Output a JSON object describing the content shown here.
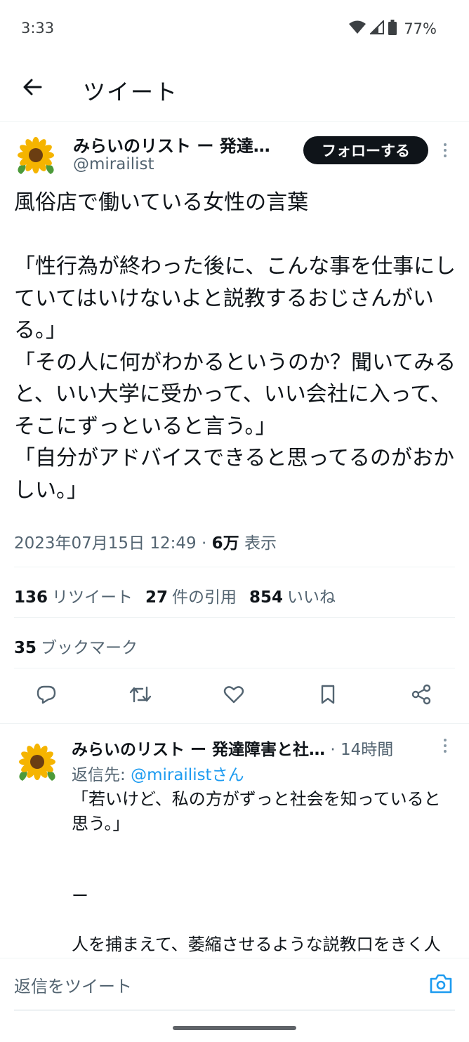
{
  "status_bar": {
    "time": "3:33",
    "battery": "77%",
    "icons": [
      "wifi-icon",
      "signal-icon",
      "battery-icon"
    ]
  },
  "header": {
    "title": "ツイート",
    "back_icon": "arrow-left-icon"
  },
  "tweet": {
    "author_name": "みらいのリスト ー 発達…",
    "handle": "@mirailist",
    "follow_label": "フォローする",
    "text": "風俗店で働いている女性の言葉\n\n「性行為が終わった後に、こんな事を仕事にしていてはいけないよと説教するおじさんがいる。」\n「その人に何がわかるというのか？聞いてみると、いい大学に受かって、いい会社に入って、そこにずっといると言う。」\n「自分がアドバイスできると思ってるのがおかしい。」",
    "date": "2023年07月15日 12:49",
    "dot": "·",
    "views_count": "6万",
    "views_label": "表示",
    "stats": {
      "retweets_count": "136",
      "retweets_label": "リツイート",
      "quotes_count": "27",
      "quotes_label": "件の引用",
      "likes_count": "854",
      "likes_label": "いいね",
      "bookmarks_count": "35",
      "bookmarks_label": "ブックマーク"
    },
    "actions": [
      "reply-icon",
      "retweet-icon",
      "like-icon",
      "bookmark-icon",
      "share-icon"
    ]
  },
  "reply": {
    "author_name": "みらいのリスト ー 発達障害と社…",
    "time": "· 14時間",
    "reply_to_label": "返信先:",
    "reply_to_mention": "@mirailistさん",
    "text": "「若いけど、私の方がずっと社会を知っていると思う。」\n\n\nー\n\n人を捕まえて、萎縮させるような説教口をきく人（このツイだとおじさん）ってこんなもので"
  },
  "composer": {
    "placeholder": "返信をツイート",
    "camera_icon": "camera-icon"
  },
  "colors": {
    "text": "#0f1419",
    "secondary": "#536471",
    "link": "#1d9bf0",
    "follow_bg": "#0f1419",
    "divider": "#eff3f4"
  }
}
